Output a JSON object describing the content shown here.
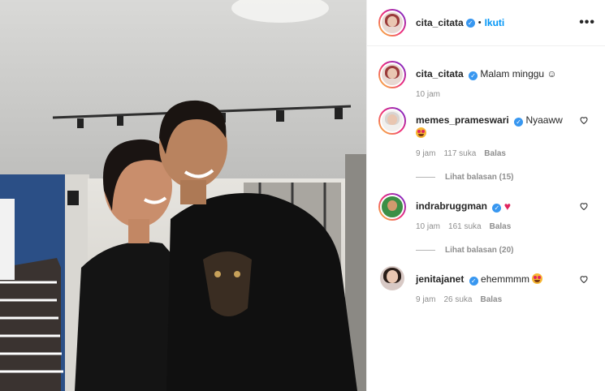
{
  "post": {
    "author": "cita_citata",
    "follow_label": "Ikuti",
    "more_label": "•••",
    "caption_text": "Malam minggu ☺",
    "caption_time": "10 jam"
  },
  "comments": [
    {
      "user": "memes_prameswari",
      "verified": true,
      "text": "Nyaaww",
      "emoji": "star-struck-emoji",
      "time": "9 jam",
      "likes": "117 suka",
      "reply": "Balas",
      "view_replies": "Lihat balasan (15)"
    },
    {
      "user": "indrabruggman",
      "verified": true,
      "text": "",
      "emoji": "red-heart-emoji",
      "time": "10 jam",
      "likes": "161 suka",
      "reply": "Balas",
      "view_replies": "Lihat balasan (20)"
    },
    {
      "user": "jenitajanet",
      "verified": true,
      "text": "ehemmmm",
      "emoji": "star-struck-emoji",
      "time": "9 jam",
      "likes": "26 suka",
      "reply": "Balas"
    }
  ],
  "colors": {
    "accent": "#0095f6",
    "verified": "#3897f0",
    "meta": "#8e8e8e",
    "heart": "#e0245e"
  },
  "icons": [
    "verified-badge-icon",
    "heart-icon",
    "more-options-icon"
  ]
}
